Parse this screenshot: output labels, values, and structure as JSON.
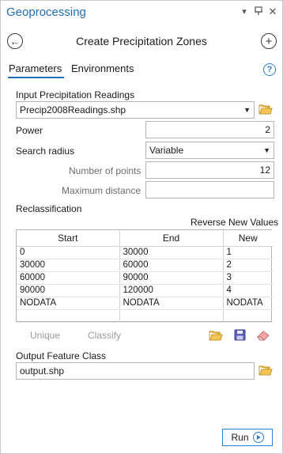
{
  "window": {
    "title": "Geoprocessing"
  },
  "tool": {
    "title": "Create Precipitation Zones"
  },
  "tabs": [
    {
      "label": "Parameters",
      "active": true
    },
    {
      "label": "Environments",
      "active": false
    }
  ],
  "params": {
    "input_label": "Input Precipitation Readings",
    "input_value": "Precip2008Readings.shp",
    "power_label": "Power",
    "power_value": "2",
    "search_radius_label": "Search radius",
    "search_radius_value": "Variable",
    "num_points_label": "Number of points",
    "num_points_value": "12",
    "max_distance_label": "Maximum distance",
    "max_distance_value": "",
    "reclass_label": "Reclassification",
    "reverse_label": "Reverse New Values"
  },
  "table": {
    "headers": [
      "Start",
      "End",
      "New"
    ],
    "rows": [
      [
        "0",
        "30000",
        "1"
      ],
      [
        "30000",
        "60000",
        "2"
      ],
      [
        "60000",
        "90000",
        "3"
      ],
      [
        "90000",
        "120000",
        "4"
      ],
      [
        "NODATA",
        "NODATA",
        "NODATA"
      ],
      [
        "",
        "",
        ""
      ]
    ]
  },
  "actions": {
    "unique_label": "Unique",
    "classify_label": "Classify"
  },
  "output": {
    "label": "Output Feature Class",
    "value": "output.shp"
  },
  "run": {
    "label": "Run"
  },
  "colors": {
    "accent": "#1e6fb8",
    "folder": "#e8b339"
  }
}
